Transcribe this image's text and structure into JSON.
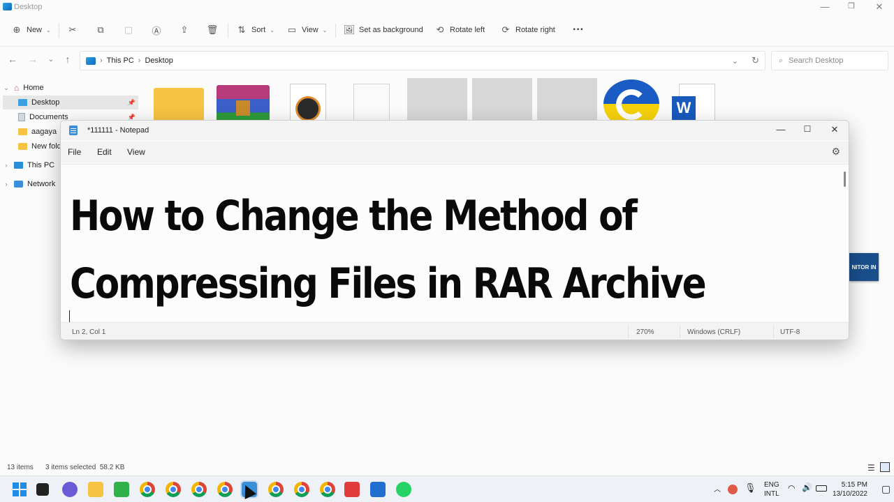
{
  "explorer": {
    "title": "Desktop",
    "toolbar": {
      "new_label": "New",
      "sort_label": "Sort",
      "view_label": "View",
      "set_background_label": "Set as background",
      "rotate_left_label": "Rotate left",
      "rotate_right_label": "Rotate right",
      "more_label": "···"
    },
    "address": {
      "segments": [
        "This PC",
        "Desktop"
      ],
      "separator": "›"
    },
    "search_placeholder": "Search Desktop",
    "sidebar": {
      "items": [
        {
          "label": "Home",
          "icon": "home-icon"
        },
        {
          "label": "Desktop",
          "icon": "desktop-icon",
          "selected": true
        },
        {
          "label": "Documents",
          "icon": "documents-icon"
        },
        {
          "label": "aagaya",
          "icon": "folder-icon"
        },
        {
          "label": "New fold",
          "icon": "folder-icon"
        },
        {
          "label": "This PC",
          "icon": "pc-icon"
        },
        {
          "label": "Network",
          "icon": "network-icon"
        }
      ]
    },
    "status": {
      "item_count": "13 items",
      "selection": "3 items selected  58.2 KB"
    },
    "right_tile_label": "NITOR IN"
  },
  "notepad": {
    "title": "*111111 - Notepad",
    "menu": [
      "File",
      "Edit",
      "View"
    ],
    "content_line1": "How to Change the Method of",
    "content_line2": "Compressing Files in RAR Archive",
    "status": {
      "position": "Ln 2, Col 1",
      "zoom": "270%",
      "line_ending": "Windows (CRLF)",
      "encoding": "UTF-8"
    }
  },
  "taskbar": {
    "lang_line1": "ENG",
    "lang_line2": "INTL",
    "time": "5:15 PM",
    "date": "13/10/2022"
  }
}
